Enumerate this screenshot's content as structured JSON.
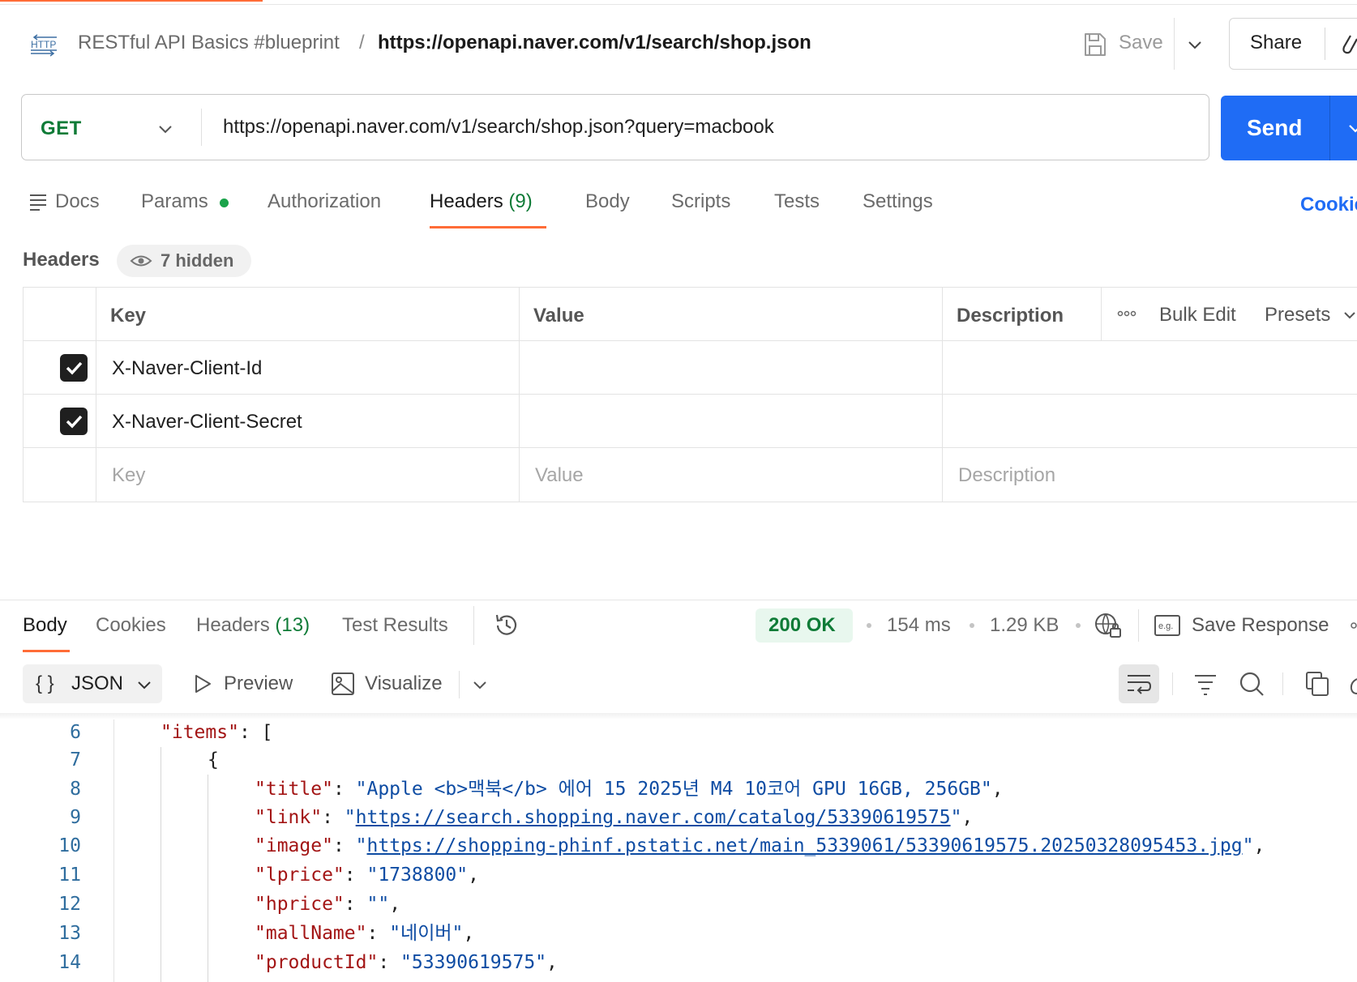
{
  "header": {
    "collection": "RESTful API Basics #blueprint",
    "separator": "/",
    "request_name": "https://openapi.naver.com/v1/search/shop.json",
    "save_label": "Save",
    "share_label": "Share",
    "http_icon_text": "HTTP"
  },
  "request": {
    "method": "GET",
    "url": "https://openapi.naver.com/v1/search/shop.json?query=macbook",
    "send_label": "Send"
  },
  "request_tabs": {
    "docs": "Docs",
    "params": "Params",
    "authorization": "Authorization",
    "headers": "Headers",
    "headers_count": "(9)",
    "body": "Body",
    "scripts": "Scripts",
    "tests": "Tests",
    "settings": "Settings",
    "cookies": "Cookies",
    "active": "Headers"
  },
  "headers_section": {
    "title": "Headers",
    "hidden_label": "7 hidden",
    "columns": {
      "key": "Key",
      "value": "Value",
      "description": "Description"
    },
    "bulk_edit": "Bulk Edit",
    "presets": "Presets",
    "rows": [
      {
        "key": "X-Naver-Client-Id",
        "checked": true
      },
      {
        "key": "X-Naver-Client-Secret",
        "checked": true
      }
    ],
    "placeholders": {
      "key": "Key",
      "value": "Value",
      "description": "Description"
    }
  },
  "response": {
    "tabs": {
      "body": "Body",
      "cookies": "Cookies",
      "headers": "Headers",
      "headers_count": "(13)",
      "test_results": "Test Results"
    },
    "status": "200 OK",
    "time": "154 ms",
    "size": "1.29 KB",
    "save_response": "Save Response",
    "format": "JSON",
    "format_icon": "{ }",
    "preview": "Preview",
    "visualize": "Visualize",
    "save_icon_text": "e.g."
  },
  "code": {
    "lines": [
      {
        "num": "6",
        "key": "\"items\"",
        "rest": ": ["
      },
      {
        "num": "7",
        "text": "{"
      },
      {
        "num": "8",
        "key": "\"title\"",
        "sep": ": ",
        "value": "\"Apple <b>맥북</b> 에어 15 2025년 M4 10코어 GPU 16GB, 256GB\"",
        "tail": ","
      },
      {
        "num": "9",
        "key": "\"link\"",
        "sep": ": ",
        "q1": "\"",
        "url": "https://search.shopping.naver.com/catalog/53390619575",
        "q2": "\"",
        "tail": ","
      },
      {
        "num": "10",
        "key": "\"image\"",
        "sep": ": ",
        "q1": "\"",
        "url": "https://shopping-phinf.pstatic.net/main_5339061/53390619575.20250328095453.jpg",
        "q2": "\"",
        "tail": ","
      },
      {
        "num": "11",
        "key": "\"lprice\"",
        "sep": ": ",
        "value": "\"1738800\"",
        "tail": ","
      },
      {
        "num": "12",
        "key": "\"hprice\"",
        "sep": ": ",
        "value": "\"\"",
        "tail": ","
      },
      {
        "num": "13",
        "key": "\"mallName\"",
        "sep": ": ",
        "value": "\"네이버\"",
        "tail": ","
      },
      {
        "num": "14",
        "key": "\"productId\"",
        "sep": ": ",
        "value": "\"53390619575\"",
        "tail": ","
      }
    ]
  },
  "colors": {
    "accent": "#ff6c37",
    "send": "#1f6cf5",
    "method_get": "#0f7b37",
    "status_ok": "#0f7b37"
  }
}
